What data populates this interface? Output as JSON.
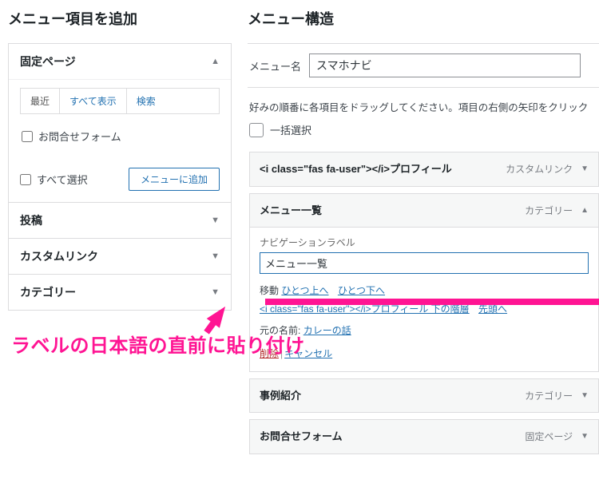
{
  "left": {
    "heading": "メニュー項目を追加",
    "sections": {
      "pages": {
        "title": "固定ページ",
        "tabs": {
          "recent": "最近",
          "all": "すべて表示",
          "search": "検索"
        },
        "item1": "お問合せフォーム",
        "select_all": "すべて選択",
        "add_btn": "メニューに追加"
      },
      "posts": {
        "title": "投稿"
      },
      "custom": {
        "title": "カスタムリンク"
      },
      "cats": {
        "title": "カテゴリー"
      }
    }
  },
  "right": {
    "heading": "メニュー構造",
    "menu_name_label": "メニュー名",
    "menu_name_value": "スマホナビ",
    "hint": "好みの順番に各項目をドラッグしてください。項目の右側の矢印をクリック",
    "bulk_select": "一括選択",
    "items": {
      "profile": {
        "title": "<i class=\"fas fa-user\"></i>プロフィール",
        "type": "カスタムリンク"
      },
      "menulist": {
        "title": "メニュー一覧",
        "type": "カテゴリー",
        "nav_label_label": "ナビゲーションラベル",
        "nav_label_value": "メニュー一覧",
        "move_label": "移動",
        "move_up": "ひとつ上へ",
        "move_down": "ひとつ下へ",
        "move_under": "<i class=\"fas fa-user\"></i>プロフィール 下の階層",
        "move_top": "先頭へ",
        "orig_label": "元の名前:",
        "orig_link": "カレーの話",
        "delete": "削除",
        "cancel": "キャンセル"
      },
      "jirei": {
        "title": "事例紹介",
        "type": "カテゴリー"
      },
      "contact": {
        "title": "お問合せフォーム",
        "type": "固定ページ"
      }
    }
  },
  "annotation": {
    "text": "ラベルの日本語の直前に貼り付け"
  }
}
